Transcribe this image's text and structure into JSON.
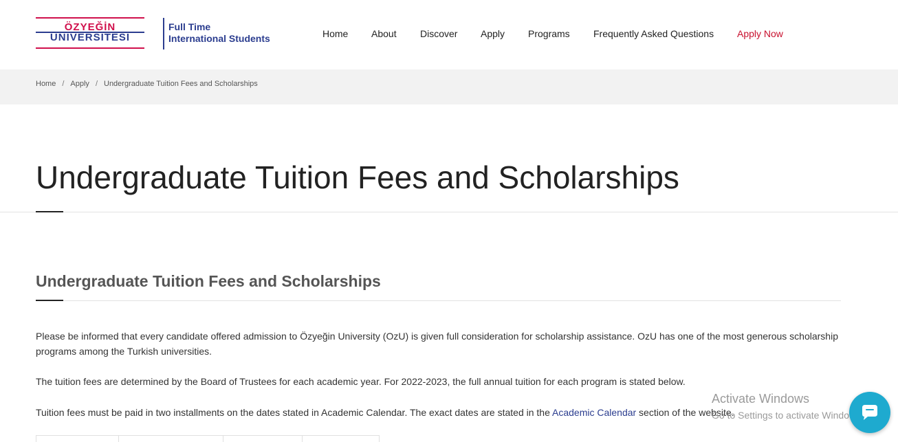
{
  "logo": {
    "line1": "ÖZYEĞİN",
    "line2": "ÜNİVERSİTESİ",
    "subtitle_line1": "Full Time",
    "subtitle_line2": "International Students"
  },
  "nav": {
    "items": [
      {
        "label": "Home"
      },
      {
        "label": "About"
      },
      {
        "label": "Discover"
      },
      {
        "label": "Apply"
      },
      {
        "label": "Programs"
      },
      {
        "label": "Frequently Asked Questions"
      },
      {
        "label": "Apply Now"
      }
    ]
  },
  "breadcrumb": {
    "items": [
      "Home",
      "Apply",
      "Undergraduate Tuition Fees and Scholarships"
    ],
    "separator": "/"
  },
  "main": {
    "page_title": "Undergraduate Tuition Fees and Scholarships",
    "section_title": "Undergraduate Tuition Fees and Scholarships",
    "paragraph1": "Please be informed that every candidate offered admission to Özyeğin University (OzU) is given full consideration for scholarship assistance. OzU has one of the most generous scholarship programs among the Turkish universities.",
    "paragraph2": "The tuition fees are determined by the Board of Trustees for each academic year. For 2022-2023, the full annual tuition for each program is stated below.",
    "paragraph3_before": "Tuition fees must be paid in two installments on the dates stated in Academic Calendar. The exact dates are stated in the ",
    "paragraph3_link": "Academic Calendar",
    "paragraph3_after": " section of the website."
  },
  "watermark": {
    "line1": "Activate Windows",
    "line2": "Go to Settings to activate Windows."
  },
  "colors": {
    "brand_blue": "#2b3d8f",
    "brand_red": "#d0104c",
    "apply_now": "#c8102e",
    "chat_bubble": "#1eaacf"
  },
  "icons": {
    "chat": "chat-bubble-icon"
  }
}
